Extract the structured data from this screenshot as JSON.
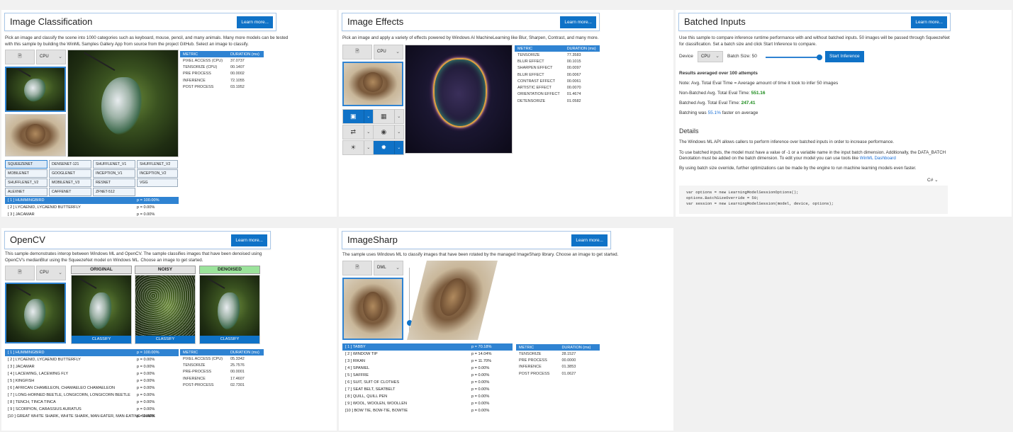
{
  "learn_more": "Learn more...",
  "classification": {
    "title": "Image Classification",
    "description": "Pick an image and classify the scene into 1000 categories such as keyboard, mouse, pencil, and many animals. Many more models can be tested with this sample by building the WinML Samples Gallery App from source from the project GitHub. Select an image to classify.",
    "device": "CPU",
    "stats_headers": [
      "METRIC",
      "DURATION (ms)"
    ],
    "stats": [
      [
        "PIXEL ACCESS (CPU)",
        "37.0737"
      ],
      [
        "TENSORIZE (CPU)",
        "00.1407"
      ],
      [
        "PRE PROCESS",
        "00.0002"
      ],
      [
        "INFERENCE",
        "72.1055"
      ],
      [
        "POST PROCESS",
        "03.1952"
      ]
    ],
    "models": [
      "SQUEEZENET",
      "DENSENET-121",
      "SHUFFLENET_V1",
      "SHUFFLENET_V2",
      "MOBILENET",
      "GOOGLENET",
      "INCEPTION_V1",
      "INCEPTION_V2",
      "SHUFFLENET_V2",
      "MOBILENET_V3",
      "RESNET",
      "VGG",
      "ALEXNET",
      "CAFFENET",
      "ZFNET-512"
    ],
    "results": [
      [
        "[ 1 ]  HUMMINGBIRD",
        "p = 100.00%"
      ],
      [
        "[ 2 ]  LYCAENID, LYCAENID BUTTERFLY",
        "p = 0.00%"
      ],
      [
        "[ 3 ]  JACAMAR",
        "p = 0.00%"
      ]
    ]
  },
  "effects": {
    "title": "Image Effects",
    "description": "Pick an image and apply a variety of effects powered by Windows AI MachineLearning like Blur, Sharpen, Contrast, and many more.",
    "device": "CPU",
    "stats_headers": [
      "METRIC",
      "DURATION (ms)"
    ],
    "stats": [
      [
        "TENSORIZE",
        "77.3583"
      ],
      [
        "BLUR EFFECT",
        "00.1015"
      ],
      [
        "SHARPEN EFFECT",
        "00.0097"
      ],
      [
        "BLUR EFFECT",
        "00.0067"
      ],
      [
        "CONTRAST EFFECT",
        "00.0061"
      ],
      [
        "ARTISTIC EFFECT",
        "00.0070"
      ],
      [
        "ORIENTATION EFFECT",
        "01.4674"
      ],
      [
        "DETENSORIZE",
        "01.0582"
      ]
    ]
  },
  "batched": {
    "title": "Batched Inputs",
    "description": "Use this sample to compare inference runtime performance with and without batched inputs. 50 images will be passed through SqueezeNet for classification. Set a batch size and click Start Inference to compare.",
    "device_label": "Device",
    "device": "CPU",
    "batch_label": "Batch Size: 50",
    "batch_fraction": 1.0,
    "start_label": "Start Inference",
    "results_heading": "Results averaged over 100 attempts",
    "note": "Note: Avg. Total Eval Time = Average amount of time it took to infer 50 images",
    "non_batched_label": "Non-Batched Avg. Total Eval Time:",
    "non_batched_value": "551.16",
    "batched_label": "Batched Avg. Total Eval Time:",
    "batched_value": "247.41",
    "batching_prefix": "Batching was",
    "batching_value": "55.1%",
    "batching_suffix": "faster on average",
    "details_heading": "Details",
    "details_p1": "The Windows ML API allows callers to perform inference over batched inputs in order to increase performance.",
    "details_p2a": "To use batched inputs, the model must have a value of -1 or a variable name in the input batch dimension. Additionally, the DATA_BATCH",
    "details_p2b": "Denotation must be added on the batch dimension. To edit your model you can use tools like",
    "details_link": "WinML Dashboard",
    "details_p3": "By using batch size override, further optimizations can be made by the engine to run machine learning models even faster.",
    "lang": "C#",
    "code": [
      "var options = new LearningModelSessionOptions();",
      "options.BatchSizeOverride = 50;",
      "var session = new LearningModelSession(model, device, options);"
    ]
  },
  "opencv": {
    "title": "OpenCV",
    "description": "This sample demonstrates interop between Windows ML and OpenCV. The sample classifies images that have been denoised using OpenCV's medianBlur using the SqueezeNet model on Windows ML. Choose an image to get started.",
    "device": "CPU",
    "col_original": "ORIGINAL",
    "col_noisy": "NOISY",
    "col_denoised": "DENOISED",
    "classify": "CLASSIFY",
    "results": [
      [
        "[ 1 ]  HUMMINGBIRD",
        "p = 100.00%"
      ],
      [
        "[ 2 ]  LYCAENID, LYCAENID BUTTERFLY",
        "p = 0.00%"
      ],
      [
        "[ 3 ]  JACAMAR",
        "p = 0.00%"
      ],
      [
        "[ 4 ]  LACEWING, LACEWING FLY",
        "p = 0.00%"
      ],
      [
        "[ 5 ]  KINGFISH",
        "p = 0.00%"
      ],
      [
        "[ 6 ]  AFRICAN CHAMELEON, CHAMAELEO CHAMAELEON",
        "p = 0.00%"
      ],
      [
        "[ 7 ]  LONG-HORNED BEETLE, LONGICORN, LONGICORN BEETLE",
        "p = 0.00%"
      ],
      [
        "[ 8 ]  TENCH, TINCA TINCA",
        "p = 0.00%"
      ],
      [
        "[ 9 ]  SCORPION, CARASSIUS AURATUS",
        "p = 0.00%"
      ],
      [
        "[10 ]  GREAT WHITE SHARK, WHITE SHARK, MAN-EATER, MAN-EATING SHARK",
        "p = 0.00%"
      ]
    ],
    "stats_headers": [
      "METRIC",
      "DURATION (ms)"
    ],
    "stats": [
      [
        "PIXEL ACCESS (CPU)",
        "05.3342"
      ],
      [
        "TENSORIZE",
        "25.7576"
      ],
      [
        "PRE-PROCESS",
        "00.0001"
      ],
      [
        "INFERENCE",
        "17.4607"
      ],
      [
        "POST-PROCESS",
        "02.7301"
      ]
    ]
  },
  "imagesharp": {
    "title": "ImageSharp",
    "description": "The sample uses Windows ML to classify images that have been rotated by the managed ImageSharp library. Choose an image to get started.",
    "device": "DML",
    "results": [
      [
        "[ 1 ]  TABBY",
        "p = 70.18%"
      ],
      [
        "[ 2 ]  WINDOW TIP",
        "p = 14.04%"
      ],
      [
        "[ 3 ]  RIKAN",
        "p = 11.70%"
      ],
      [
        "[ 4 ]  SPANIEL",
        "p = 0.00%"
      ],
      [
        "[ 5 ]  SAFFRE",
        "p = 0.00%"
      ],
      [
        "[ 6 ]  SUIT, SUIT OF CLOTHES",
        "p = 0.00%"
      ],
      [
        "[ 7 ]  SEAT BELT, SEATBELT",
        "p = 0.00%"
      ],
      [
        "[ 8 ]  QUILL, QUILL PEN",
        "p = 0.00%"
      ],
      [
        "[ 9 ]  WOOL, WOOLEN, WOOLLEN",
        "p = 0.00%"
      ],
      [
        "[10 ]  BOW TIE, BOW-TIE, BOWTIE",
        "p = 0.00%"
      ]
    ],
    "stats_headers": [
      "METRIC",
      "DURATION (ms)"
    ],
    "stats": [
      [
        "TENSORIZE",
        "28.1527"
      ],
      [
        "PRE PROCESS",
        "00.0000"
      ],
      [
        "INFERENCE",
        "01.3853"
      ],
      [
        "POST PROCESS",
        "01.0627"
      ]
    ]
  }
}
